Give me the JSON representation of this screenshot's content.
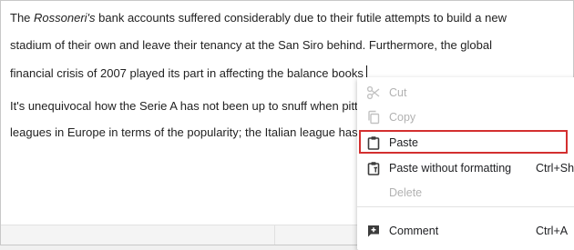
{
  "document": {
    "line1": {
      "prefix": "The ",
      "italic": "Rossoneri's",
      "suffix": " bank accounts suffered considerably due to their futile attempts to build a new"
    },
    "line2": "stadium of their own and leave their tenancy at the San Siro behind. Furthermore, the global",
    "line3": "financial crisis of 2007 played its part in affecting the balance books",
    "line4": "It's unequivocal how the Serie A has not been up to snuff when pitted",
    "line5": "leagues in Europe in terms of the popularity; the Italian league has se"
  },
  "context_menu": {
    "items": [
      {
        "label": "Cut",
        "shortcut": "",
        "icon": "scissors-icon",
        "enabled": false
      },
      {
        "label": "Copy",
        "shortcut": "",
        "icon": "copy-icon",
        "enabled": false
      },
      {
        "label": "Paste",
        "shortcut": "",
        "icon": "clipboard-icon",
        "enabled": true,
        "highlighted": true
      },
      {
        "label": "Paste without formatting",
        "shortcut": "Ctrl+Sh",
        "icon": "clipboard-text-icon",
        "enabled": true
      },
      {
        "label": "Delete",
        "shortcut": "",
        "icon": "",
        "enabled": false
      },
      {
        "label": "Comment",
        "shortcut": "Ctrl+A",
        "icon": "add-comment-icon",
        "enabled": true
      }
    ]
  },
  "colors": {
    "highlight_border": "#d32f2f",
    "disabled_text": "#b2b2b2",
    "text": "#202124"
  }
}
